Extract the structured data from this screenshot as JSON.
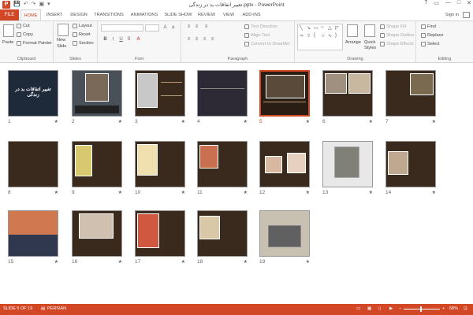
{
  "window": {
    "title": "تغییر اتفاقات بد در زندگی.pptx - PowerPoint",
    "app_icon": "P",
    "controls": [
      "?",
      "▭",
      "—",
      "□",
      "✕"
    ]
  },
  "quick_access": {
    "save": "💾",
    "undo": "↶",
    "redo": "↷",
    "start": "▣",
    "more": "▾"
  },
  "tabs": {
    "file": "FILE",
    "items": [
      "HOME",
      "INSERT",
      "DESIGN",
      "TRANSITIONS",
      "ANIMATIONS",
      "SLIDE SHOW",
      "REVIEW",
      "VIEW",
      "ADD-INS"
    ],
    "active": "HOME",
    "sign_in": "Sign in"
  },
  "ribbon": {
    "clipboard": {
      "label": "Clipboard",
      "paste": "Paste",
      "cut": "Cut",
      "copy": "Copy",
      "format_painter": "Format Painter"
    },
    "slides": {
      "label": "Slides",
      "new_slide": "New",
      "new_slide2": "Slide",
      "layout": "Layout",
      "reset": "Reset",
      "section": "Section"
    },
    "font": {
      "label": "Font"
    },
    "paragraph": {
      "label": "Paragraph",
      "text_direction": "Text Direction",
      "align_text": "Align Text",
      "convert": "Convert to SmartArt"
    },
    "drawing": {
      "label": "Drawing",
      "arrange": "Arrange",
      "quick_styles": "Quick",
      "quick_styles2": "Styles",
      "shape_fill": "Shape Fill",
      "shape_outline": "Shape Outline",
      "shape_effects": "Shape Effects"
    },
    "editing": {
      "label": "Editing",
      "find": "Find",
      "replace": "Replace",
      "select": "Select"
    }
  },
  "slides": [
    {
      "num": "1",
      "title": "تغییر اتفاقات بد در زندگی",
      "selected": false
    },
    {
      "num": "2",
      "selected": false
    },
    {
      "num": "3",
      "selected": false
    },
    {
      "num": "4",
      "selected": false
    },
    {
      "num": "5",
      "selected": true
    },
    {
      "num": "6",
      "selected": false
    },
    {
      "num": "7",
      "selected": false
    },
    {
      "num": "8",
      "selected": false
    },
    {
      "num": "9",
      "selected": false
    },
    {
      "num": "10",
      "selected": false
    },
    {
      "num": "11",
      "selected": false
    },
    {
      "num": "12",
      "selected": false
    },
    {
      "num": "13",
      "selected": false
    },
    {
      "num": "14",
      "selected": false
    },
    {
      "num": "15",
      "selected": false
    },
    {
      "num": "16",
      "selected": false
    },
    {
      "num": "17",
      "selected": false
    },
    {
      "num": "18",
      "selected": false
    },
    {
      "num": "19",
      "selected": false
    }
  ],
  "star": "★",
  "status": {
    "slide": "SLIDE 5 OF 19",
    "language": "PERSIAN",
    "zoom": "68%",
    "zoom_out": "−",
    "zoom_in": "+"
  },
  "colors": {
    "accent": "#d24726",
    "slide_bg": "#3a2a1e"
  }
}
